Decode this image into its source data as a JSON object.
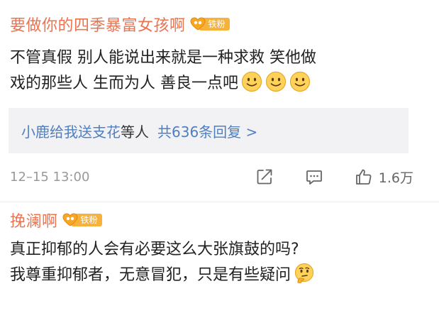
{
  "comments": [
    {
      "username": "要做你的四季暴富女孩啊",
      "badge": "铁粉",
      "text_lines": [
        "不管真假 别人能说出来就是一种求救 笑他做",
        "戏的那些人 生而为人 善良一点吧"
      ],
      "emoji_icon": "smile-emoji",
      "emoji_count_shown": 3,
      "replies": {
        "user": "小鹿给我送支花",
        "suffix": "等人",
        "count_label": "共636条回复 >"
      },
      "timestamp": "12–15 13:00",
      "like_count": "1.6万"
    },
    {
      "username": "挽澜啊",
      "badge": "铁粉",
      "text_lines": [
        "真正抑郁的人会有必要这么大张旗鼓的吗?",
        "我尊重抑郁者，无意冒犯，只是有些疑问"
      ],
      "emoji_icon": "thinking-emoji"
    }
  ],
  "colors": {
    "username": "#eb7350",
    "link": "#4f7fc0",
    "badge": "#f7b23b",
    "reply_box_bg": "#f2f2f5",
    "meta_text": "#999999"
  }
}
